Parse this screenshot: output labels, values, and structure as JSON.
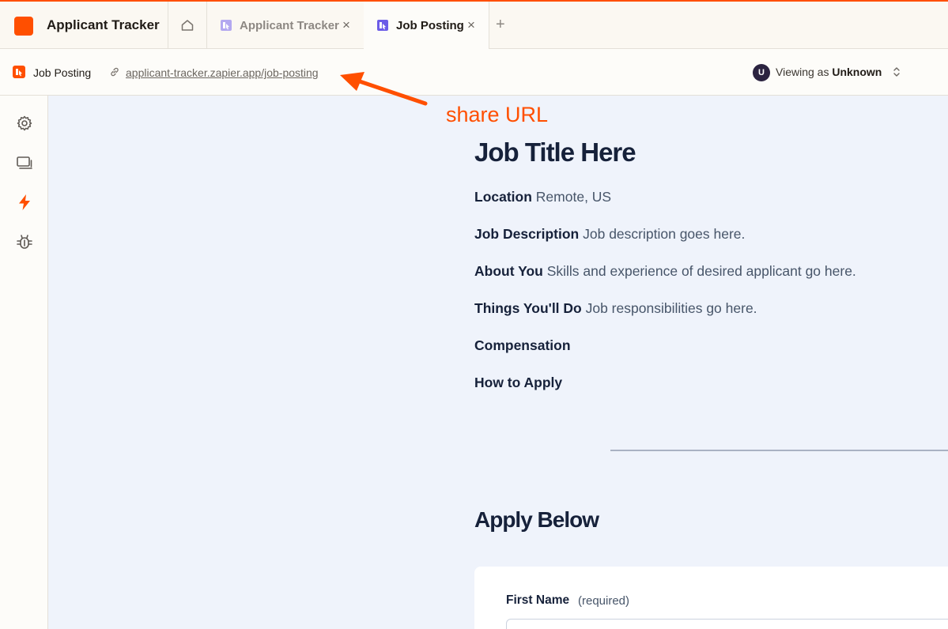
{
  "app": {
    "title": "Applicant Tracker"
  },
  "tabs": [
    {
      "label": "Applicant Tracker",
      "close": "×"
    },
    {
      "label": "Job Posting",
      "close": "×"
    }
  ],
  "new_tab": "+",
  "subbar": {
    "page_name": "Job Posting",
    "share_url": "applicant-tracker.zapier.app/job-posting",
    "viewer_initial": "U",
    "viewer_prefix": "Viewing as",
    "viewer_name": "Unknown"
  },
  "annotation": {
    "text": "share URL",
    "color": "#ff4f00"
  },
  "job": {
    "title": "Job Title Here",
    "fields": [
      {
        "key": "Location",
        "value": "Remote, US"
      },
      {
        "key": "Job Description",
        "value": "Job description goes here."
      },
      {
        "key": "About You",
        "value": "Skills and experience of desired applicant go here."
      },
      {
        "key": "Things You'll Do",
        "value": "Job responsibilities go here."
      },
      {
        "key": "Compensation",
        "value": ""
      },
      {
        "key": "How to Apply",
        "value": ""
      }
    ]
  },
  "apply": {
    "title": "Apply Below",
    "first_name_label": "First Name",
    "first_name_required": "(required)",
    "first_name_value": ""
  },
  "sidebar_icons": [
    "gear-icon",
    "layout-icon",
    "lightning-icon",
    "bug-icon"
  ],
  "colors": {
    "brand": "#ff4f00",
    "background": "#eff3fb",
    "tab_icon": "#6c5ce7"
  }
}
